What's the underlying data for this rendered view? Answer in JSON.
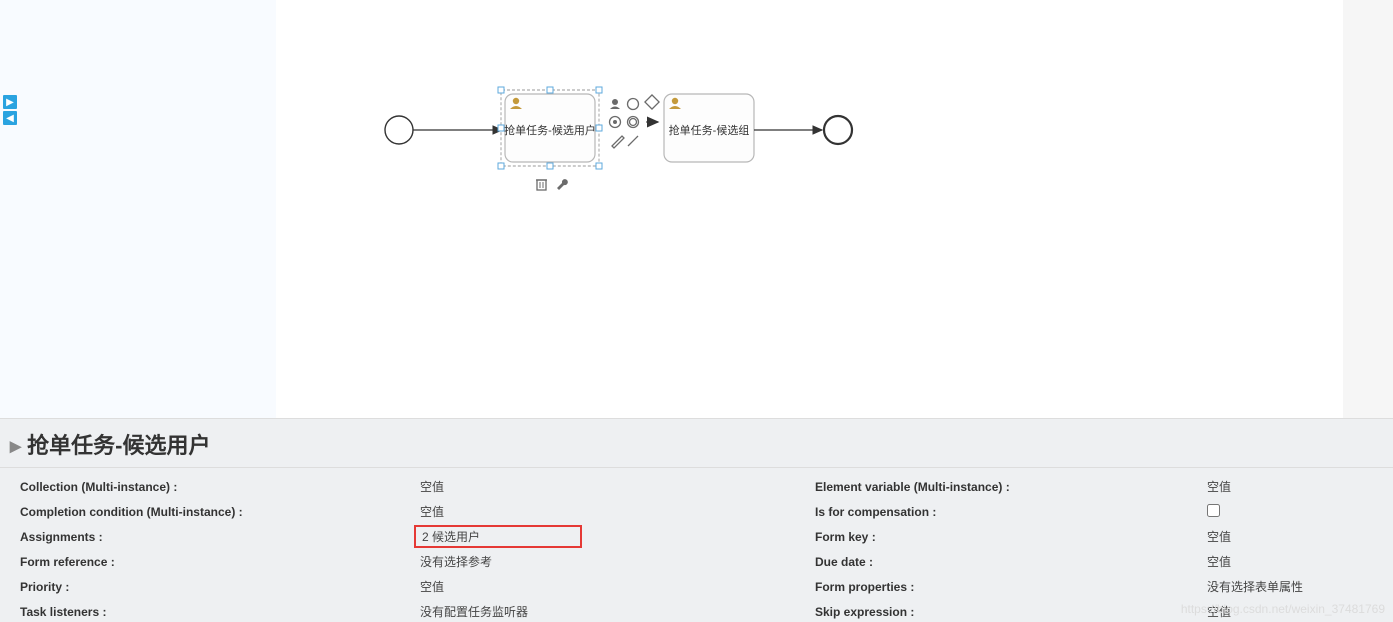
{
  "panel_title": "抢单任务-候选用户",
  "diag": {
    "task1_label": "抢单任务-候选用户",
    "task2_label": "抢单任务-候选组"
  },
  "left_props": [
    {
      "label": "Collection (Multi-instance) :",
      "value": "空值"
    },
    {
      "label": "Completion condition (Multi-instance) :",
      "value": "空值"
    },
    {
      "label": "Assignments :",
      "value": "2 候选用户",
      "highlighted": true
    },
    {
      "label": "Form reference :",
      "value": "没有选择参考"
    },
    {
      "label": "Priority :",
      "value": "空值"
    },
    {
      "label": "Task listeners :",
      "value": "没有配置任务监听器"
    }
  ],
  "right_props": [
    {
      "label": "Element variable (Multi-instance) :",
      "value": "空值"
    },
    {
      "label": "Is for compensation :",
      "checkbox": true,
      "checked": false
    },
    {
      "label": "Form key :",
      "value": "空值"
    },
    {
      "label": "Due date :",
      "value": "空值"
    },
    {
      "label": "Form properties :",
      "value": "没有选择表单属性"
    },
    {
      "label": "Skip expression :",
      "value": "空值"
    }
  ],
  "watermark": "https://blog.csdn.net/weixin_37481769"
}
